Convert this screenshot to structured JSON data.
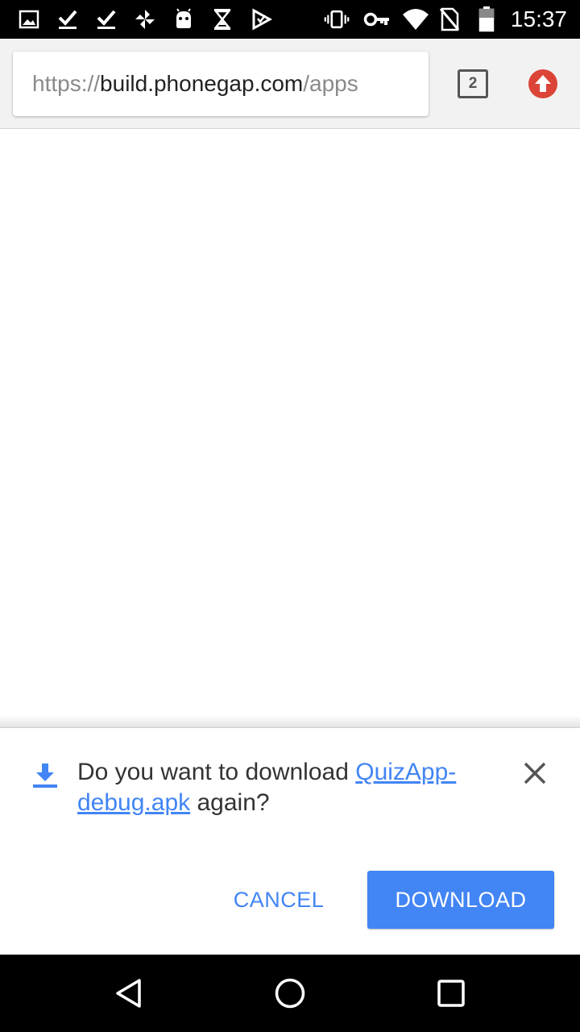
{
  "status_bar": {
    "time": "15:37",
    "icons_left": [
      "image-notification-icon",
      "check-notification-icon",
      "check-notification-icon",
      "pinwheel-app-icon",
      "android-debug-icon",
      "hourglass-icon",
      "play-store-icon"
    ],
    "icons_right": [
      "vibrate-icon",
      "vpn-key-icon",
      "wifi-icon",
      "no-sim-icon",
      "battery-icon"
    ]
  },
  "browser": {
    "url_scheme": "https://",
    "url_host": "build.phonegap.com",
    "url_path": "/apps",
    "tab_count": "2",
    "update_icon_color": "#db4437"
  },
  "download_prompt": {
    "message_prefix": "Do you want to download ",
    "file_link": "QuizApp-debug.apk",
    "message_suffix": " again?",
    "cancel_label": "CANCEL",
    "download_label": "DOWNLOAD",
    "accent_color": "#4285f4"
  },
  "nav_bar": {
    "buttons": [
      "back-icon",
      "home-icon",
      "recents-icon"
    ]
  }
}
